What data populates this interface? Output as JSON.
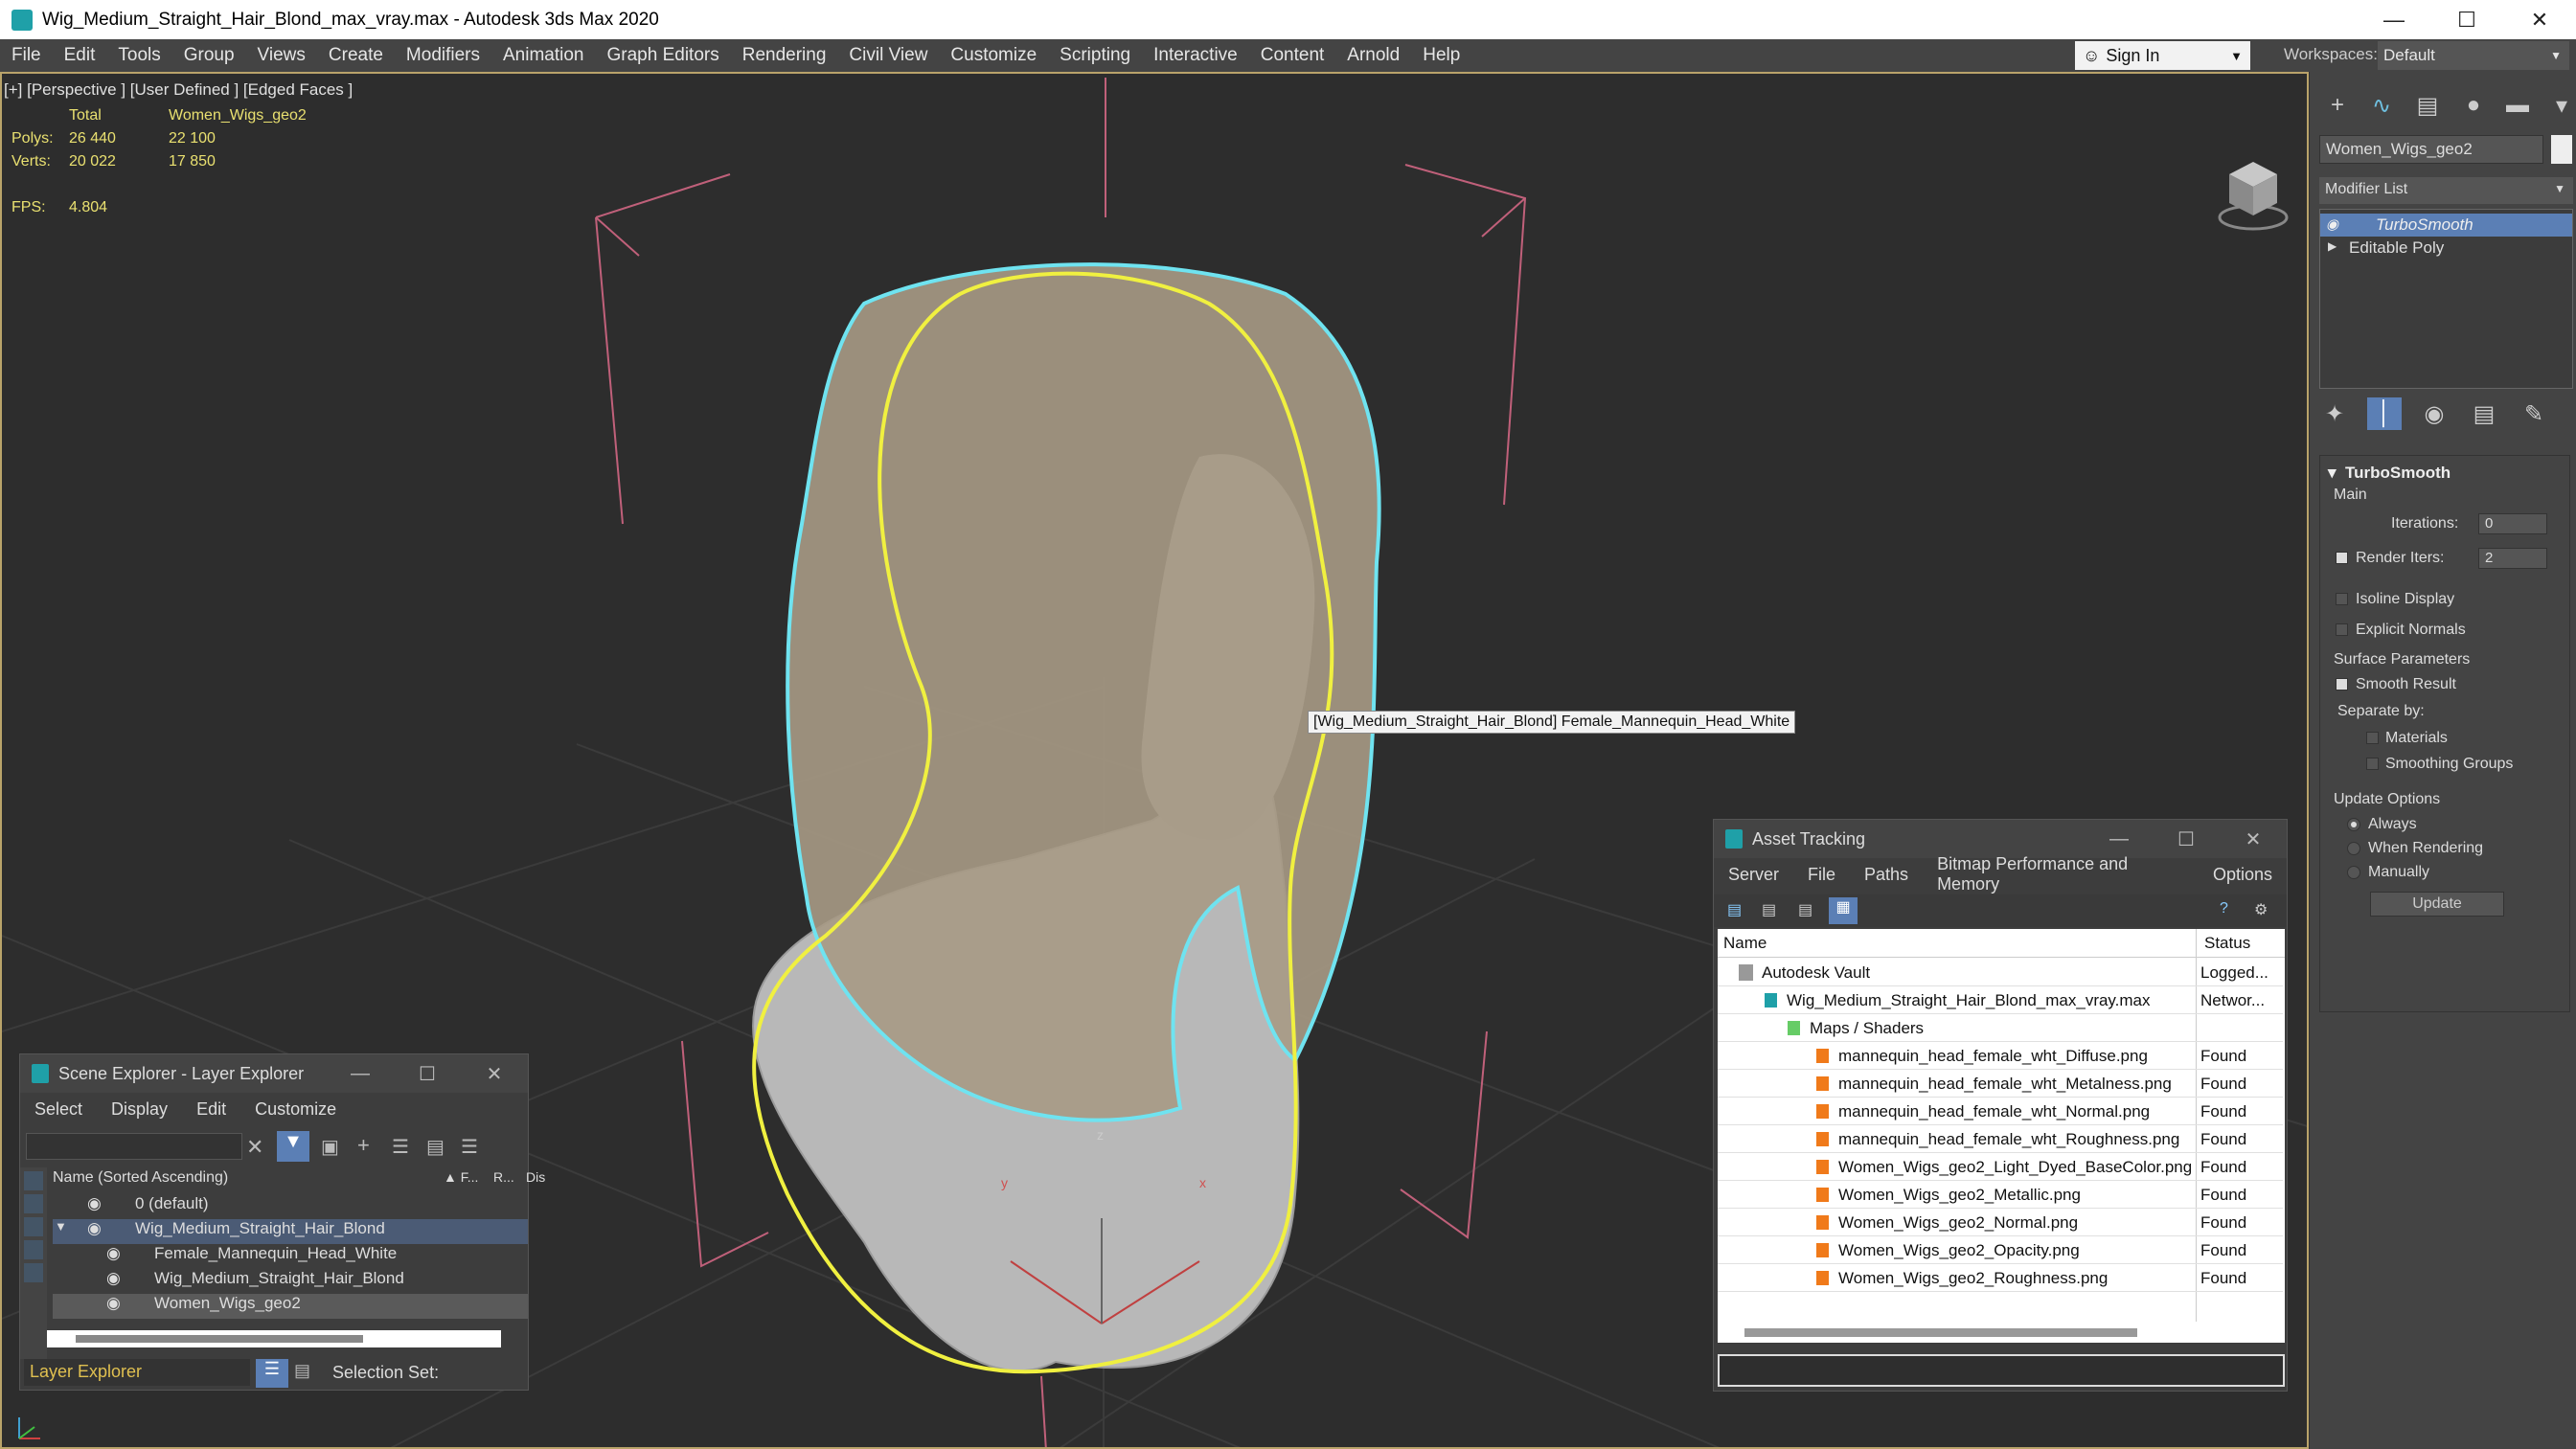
{
  "window": {
    "title": "Wig_Medium_Straight_Hair_Blond_max_vray.max - Autodesk 3ds Max 2020",
    "minimize": "—",
    "maximize": "☐",
    "close": "✕"
  },
  "menu": [
    "File",
    "Edit",
    "Tools",
    "Group",
    "Views",
    "Create",
    "Modifiers",
    "Animation",
    "Graph Editors",
    "Rendering",
    "Civil View",
    "Customize",
    "Scripting",
    "Interactive",
    "Content",
    "Arnold",
    "Help"
  ],
  "signin": {
    "label": "Sign In"
  },
  "workspace": {
    "label": "Workspaces:",
    "value": "Default"
  },
  "viewport": {
    "label": "[+] [Perspective ] [User Defined ] [Edged Faces ]",
    "stats": {
      "total_label": "Total",
      "object_label": "Women_Wigs_geo2",
      "polys_label": "Polys:",
      "polys_total": "26 440",
      "polys_obj": "22 100",
      "verts_label": "Verts:",
      "verts_total": "20 022",
      "verts_obj": "17 850",
      "fps_label": "FPS:",
      "fps_value": "4.804"
    },
    "tooltip": "[Wig_Medium_Straight_Hair_Blond] Female_Mannequin_Head_White",
    "axis_z": "z",
    "axis_y": "y",
    "axis_x": "x"
  },
  "command_panel": {
    "object_name": "Women_Wigs_geo2",
    "modifier_list": "Modifier List",
    "stack": [
      "TurboSmooth",
      "Editable Poly"
    ],
    "rollout_title": "TurboSmooth",
    "main_label": "Main",
    "iterations_label": "Iterations:",
    "iterations_value": "0",
    "render_iters_label": "Render Iters:",
    "render_iters_value": "2",
    "isoline_label": "Isoline Display",
    "explicit_normals_label": "Explicit Normals",
    "surface_params_label": "Surface Parameters",
    "smooth_result_label": "Smooth Result",
    "separate_by_label": "Separate by:",
    "materials_label": "Materials",
    "smoothing_groups_label": "Smoothing Groups",
    "update_options_label": "Update Options",
    "always_label": "Always",
    "when_rendering_label": "When Rendering",
    "manually_label": "Manually",
    "update_button": "Update"
  },
  "scene_explorer": {
    "title": "Scene Explorer - Layer Explorer",
    "menu": [
      "Select",
      "Display",
      "Edit",
      "Customize"
    ],
    "col_name": "Name (Sorted Ascending)",
    "col_f": "▲ F...",
    "col_r": "R...",
    "col_dis": "Dis",
    "rows": [
      {
        "label": "0 (default)"
      },
      {
        "label": "Wig_Medium_Straight_Hair_Blond"
      },
      {
        "label": "Female_Mannequin_Head_White"
      },
      {
        "label": "Wig_Medium_Straight_Hair_Blond"
      },
      {
        "label": "Women_Wigs_geo2"
      }
    ],
    "footer_label": "Layer Explorer",
    "selection_set": "Selection Set:"
  },
  "asset_tracking": {
    "title": "Asset Tracking",
    "menu": [
      "Server",
      "File",
      "Paths",
      "Bitmap Performance and Memory",
      "Options"
    ],
    "col_name": "Name",
    "col_status": "Status",
    "rows": [
      {
        "name": "Autodesk Vault",
        "status": "Logged..."
      },
      {
        "name": "Wig_Medium_Straight_Hair_Blond_max_vray.max",
        "status": "Networ..."
      },
      {
        "name": "Maps / Shaders",
        "status": ""
      },
      {
        "name": "mannequin_head_female_wht_Diffuse.png",
        "status": "Found"
      },
      {
        "name": "mannequin_head_female_wht_Metalness.png",
        "status": "Found"
      },
      {
        "name": "mannequin_head_female_wht_Normal.png",
        "status": "Found"
      },
      {
        "name": "mannequin_head_female_wht_Roughness.png",
        "status": "Found"
      },
      {
        "name": "Women_Wigs_geo2_Light_Dyed_BaseColor.png",
        "status": "Found"
      },
      {
        "name": "Women_Wigs_geo2_Metallic.png",
        "status": "Found"
      },
      {
        "name": "Women_Wigs_geo2_Normal.png",
        "status": "Found"
      },
      {
        "name": "Women_Wigs_geo2_Opacity.png",
        "status": "Found"
      },
      {
        "name": "Women_Wigs_geo2_Roughness.png",
        "status": "Found"
      }
    ]
  },
  "colors": {
    "accent": "#5b7fb5",
    "stats_yellow": "#e9e070",
    "selection_cyan": "#6fe3f0",
    "selection_yellow": "#f0f040"
  }
}
